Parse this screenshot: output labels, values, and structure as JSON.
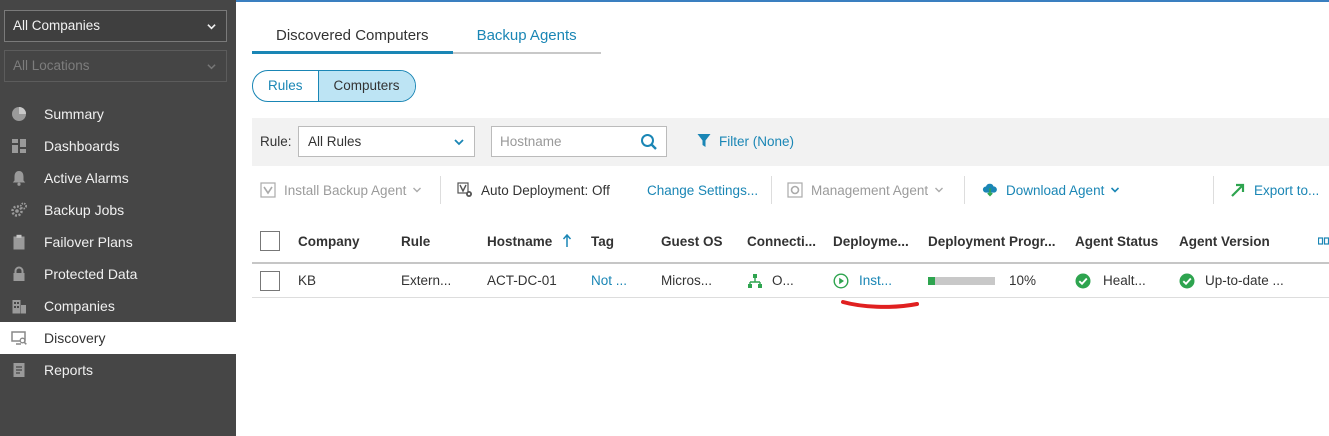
{
  "sidebar": {
    "company_select": "All Companies",
    "location_select": "All Locations",
    "items": [
      {
        "label": "Summary",
        "icon": "pie-chart-icon"
      },
      {
        "label": "Dashboards",
        "icon": "dashboard-icon"
      },
      {
        "label": "Active Alarms",
        "icon": "bell-icon"
      },
      {
        "label": "Backup Jobs",
        "icon": "gears-icon"
      },
      {
        "label": "Failover Plans",
        "icon": "clipboard-icon"
      },
      {
        "label": "Protected Data",
        "icon": "lock-icon"
      },
      {
        "label": "Companies",
        "icon": "building-icon"
      },
      {
        "label": "Discovery",
        "icon": "monitor-search-icon",
        "active": true
      },
      {
        "label": "Reports",
        "icon": "report-icon"
      }
    ]
  },
  "tabs": [
    "Discovered Computers",
    "Backup Agents"
  ],
  "view_toggle": [
    "Rules",
    "Computers"
  ],
  "filter": {
    "rule_label": "Rule:",
    "rule_value": "All Rules",
    "hostname_placeholder": "Hostname",
    "filter_label": "Filter (None)"
  },
  "toolbar": {
    "install_agent": "Install Backup Agent",
    "auto_deployment": "Auto Deployment: Off",
    "change_settings": "Change Settings...",
    "management_agent": "Management Agent",
    "download_agent": "Download Agent",
    "export": "Export to..."
  },
  "grid": {
    "columns": [
      "Company",
      "Rule",
      "Hostname",
      "Tag",
      "Guest OS",
      "Connecti...",
      "Deployme...",
      "Deployment Progr...",
      "Agent Status",
      "Agent Version"
    ],
    "rows": [
      {
        "company": "KB",
        "rule": "Extern...",
        "hostname": "ACT-DC-01",
        "tag": "Not ...",
        "guest_os": "Micros...",
        "connection": "O...",
        "deployment": "Inst...",
        "progress_text": "10%",
        "progress": 0.1,
        "agent_status": "Healt...",
        "agent_version": "Up-to-date ..."
      }
    ]
  },
  "colors": {
    "accent": "#1a86b5",
    "sidebar": "#464646",
    "success": "#2ea44f",
    "annotation": "#e02020"
  }
}
